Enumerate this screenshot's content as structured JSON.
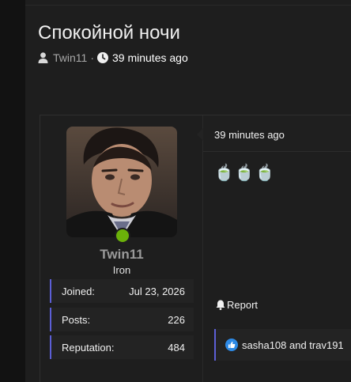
{
  "thread": {
    "title": "Спокойной ночи",
    "author": "Twin11",
    "separator": "·",
    "time": "39 minutes ago"
  },
  "post": {
    "user": {
      "name": "Twin11",
      "rank": "Iron",
      "status_color": "#6bb10a",
      "stats": [
        {
          "label": "Joined:",
          "value": "Jul 23, 2026"
        },
        {
          "label": "Posts:",
          "value": "226"
        },
        {
          "label": "Reputation:",
          "value": "484"
        }
      ]
    },
    "time": "39 minutes ago",
    "content": "🍵🍵🍵",
    "report_label": "Report",
    "reactions": {
      "icon": "thumbs-up-icon",
      "text": "sasha108 and trav191"
    }
  },
  "colors": {
    "accent": "#5c5fd6",
    "like": "#2d8ae6"
  }
}
